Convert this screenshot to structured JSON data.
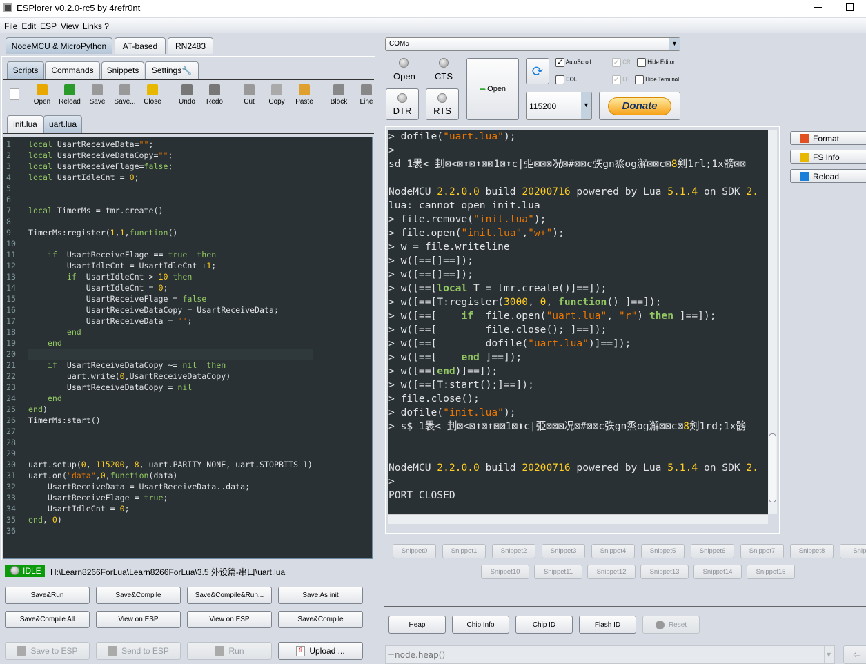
{
  "window": {
    "title": "ESPlorer v0.2.0-rc5 by 4refr0nt"
  },
  "menu": [
    "File",
    "Edit",
    "ESP",
    "View",
    "Links ?"
  ],
  "top_tabs": [
    "NodeMCU & MicroPython",
    "AT-based",
    "RN2483"
  ],
  "inner_tabs": [
    "Scripts",
    "Commands",
    "Snippets",
    "Settings"
  ],
  "toolbar": [
    "Open",
    "Reload",
    "Save",
    "Save...",
    "Close",
    "Undo",
    "Redo",
    "Cut",
    "Copy",
    "Paste",
    "Block",
    "Line"
  ],
  "file_tabs": [
    "init.lua",
    "uart.lua"
  ],
  "code_lines": [
    [
      [
        "local",
        "k"
      ],
      [
        " UsartReceiveData=",
        ""
      ],
      [
        "\"\"",
        "s"
      ],
      [
        ";",
        ""
      ]
    ],
    [
      [
        "local",
        "k"
      ],
      [
        " UsartReceiveDataCopy=",
        ""
      ],
      [
        "\"\"",
        "s"
      ],
      [
        ";",
        ""
      ]
    ],
    [
      [
        "local",
        "k"
      ],
      [
        " UsartReceiveFlage=",
        ""
      ],
      [
        "false",
        "k"
      ],
      [
        ";",
        ""
      ]
    ],
    [
      [
        "local",
        "k"
      ],
      [
        " UsartIdleCnt = ",
        ""
      ],
      [
        "0",
        "n"
      ],
      [
        ";",
        ""
      ]
    ],
    [],
    [],
    [
      [
        "local",
        "k"
      ],
      [
        " TimerMs = tmr.create()",
        ""
      ]
    ],
    [],
    [
      [
        "TimerMs:register(",
        ""
      ],
      [
        "1",
        "n"
      ],
      [
        ",",
        ""
      ],
      [
        "1",
        "n"
      ],
      [
        ",",
        ""
      ],
      [
        "function",
        "k"
      ],
      [
        "()",
        ""
      ]
    ],
    [],
    [
      [
        "    ",
        ""
      ],
      [
        "if",
        "k"
      ],
      [
        "  UsartReceiveFlage == ",
        ""
      ],
      [
        "true",
        "k"
      ],
      [
        "  ",
        ""
      ],
      [
        "then",
        "k"
      ]
    ],
    [
      [
        "        UsartIdleCnt = UsartIdleCnt +",
        ""
      ],
      [
        "1",
        "n"
      ],
      [
        ";",
        ""
      ]
    ],
    [
      [
        "        ",
        ""
      ],
      [
        "if",
        "k"
      ],
      [
        "  UsartIdleCnt > ",
        ""
      ],
      [
        "10",
        "n"
      ],
      [
        " ",
        ""
      ],
      [
        "then",
        "k"
      ]
    ],
    [
      [
        "            UsartIdleCnt = ",
        ""
      ],
      [
        "0",
        "n"
      ],
      [
        ";",
        ""
      ]
    ],
    [
      [
        "            UsartReceiveFlage = ",
        ""
      ],
      [
        "false",
        "k"
      ]
    ],
    [
      [
        "            UsartReceiveDataCopy = UsartReceiveData;",
        ""
      ]
    ],
    [
      [
        "            UsartReceiveData = ",
        ""
      ],
      [
        "\"\"",
        "s"
      ],
      [
        ";",
        ""
      ]
    ],
    [
      [
        "        ",
        ""
      ],
      [
        "end",
        "k"
      ]
    ],
    [
      [
        "    ",
        ""
      ],
      [
        "end",
        "k"
      ]
    ],
    [],
    [
      [
        "    ",
        ""
      ],
      [
        "if",
        "k"
      ],
      [
        "  UsartReceiveDataCopy ~= ",
        ""
      ],
      [
        "nil",
        "k"
      ],
      [
        "  ",
        ""
      ],
      [
        "then",
        "k"
      ]
    ],
    [
      [
        "        uart.write(",
        ""
      ],
      [
        "0",
        "n"
      ],
      [
        ",UsartReceiveDataCopy)",
        ""
      ]
    ],
    [
      [
        "        UsartReceiveDataCopy = ",
        ""
      ],
      [
        "nil",
        "k"
      ]
    ],
    [
      [
        "    ",
        ""
      ],
      [
        "end",
        "k"
      ]
    ],
    [
      [
        "end",
        "k"
      ],
      [
        ")",
        ""
      ]
    ],
    [
      [
        "TimerMs:start()",
        ""
      ]
    ],
    [],
    [],
    [],
    [
      [
        "uart.setup(",
        ""
      ],
      [
        "0",
        "n"
      ],
      [
        ", ",
        ""
      ],
      [
        "115200",
        "n"
      ],
      [
        ", ",
        ""
      ],
      [
        "8",
        "n"
      ],
      [
        ", uart.PARITY_NONE, uart.STOPBITS_1)",
        ""
      ]
    ],
    [
      [
        "uart.on(",
        ""
      ],
      [
        "\"data\"",
        "s"
      ],
      [
        ",",
        ""
      ],
      [
        "0",
        "n"
      ],
      [
        ",",
        ""
      ],
      [
        "function",
        "k"
      ],
      [
        "(data)",
        ""
      ]
    ],
    [
      [
        "    UsartReceiveData = UsartReceiveData..data;",
        ""
      ]
    ],
    [
      [
        "    UsartReceiveFlage = ",
        ""
      ],
      [
        "true",
        "k"
      ],
      [
        ";",
        ""
      ]
    ],
    [
      [
        "    UsartIdleCnt = ",
        ""
      ],
      [
        "0",
        "n"
      ],
      [
        ";",
        ""
      ]
    ],
    [
      [
        "end",
        "k"
      ],
      [
        ", ",
        ""
      ],
      [
        "0",
        "n"
      ],
      [
        ")",
        ""
      ]
    ],
    []
  ],
  "status": {
    "state": "IDLE",
    "path": "H:\\Learn8266ForLua\\Learn8266ForLua\\3.5 外设篇-串口\\uart.lua"
  },
  "buttons_row1": [
    "Save&Run",
    "Save&Compile",
    "Save&Compile&Run...",
    "Save As init"
  ],
  "buttons_row2": [
    "Save&Compile All",
    "View on ESP",
    "View on ESP",
    "Save&Compile"
  ],
  "buttons_row3": [
    "Save to ESP",
    "Send to ESP",
    "Run",
    "Upload ..."
  ],
  "port": {
    "value": "COM5",
    "baud": "115200",
    "open_label": "Open",
    "led_open": "Open",
    "led_cts": "CTS",
    "dtr": "DTR",
    "rts": "RTS",
    "donate": "Donate"
  },
  "options": {
    "autoscroll": "AutoScroll",
    "eol": "EOL",
    "cr": "CR",
    "lf": "LF",
    "hide_editor": "Hide Editor",
    "hide_terminal": "Hide Terminal"
  },
  "terminal_lines": [
    [
      [
        "> dofile(",
        ""
      ],
      [
        "\"uart.lua\"",
        "s"
      ],
      [
        ");",
        ""
      ]
    ],
    [
      [
        ">",
        ""
      ]
    ],
    [
      [
        "sd 1褁< 刲⊠<⊠⬆⊠⬆⊠⊠1⊠⬆c|弫⊠⊠⊠况⊠#⊠⊠c矤gn烝og澥⊠⊠c⊠",
        ""
      ],
      [
        "8",
        "n"
      ],
      [
        "剣1rl;1x髈⊠⊠",
        ""
      ]
    ],
    [],
    [
      [
        "NodeMCU ",
        ""
      ],
      [
        "2.2.0.0",
        "n"
      ],
      [
        " build ",
        ""
      ],
      [
        "20200716",
        "n"
      ],
      [
        " powered by Lua ",
        ""
      ],
      [
        "5.1.4",
        "n"
      ],
      [
        " on SDK ",
        ""
      ],
      [
        "2.",
        "n"
      ]
    ],
    [
      [
        "lua: cannot open init.lua",
        ""
      ]
    ],
    [
      [
        "> file.remove(",
        ""
      ],
      [
        "\"init.lua\"",
        "s"
      ],
      [
        ");",
        ""
      ]
    ],
    [
      [
        "> file.open(",
        ""
      ],
      [
        "\"init.lua\"",
        "s"
      ],
      [
        ",",
        ""
      ],
      [
        "\"w+\"",
        "s"
      ],
      [
        ");",
        ""
      ]
    ],
    [
      [
        "> w = file.writeline",
        ""
      ]
    ],
    [
      [
        "> w([==[]==]);",
        ""
      ]
    ],
    [
      [
        "> w([==[]==]);",
        ""
      ]
    ],
    [
      [
        "> w([==[",
        ""
      ],
      [
        "local",
        "kb"
      ],
      [
        " T = tmr.create()]==]);",
        ""
      ]
    ],
    [
      [
        "> w([==[T:register(",
        ""
      ],
      [
        "3000",
        "n"
      ],
      [
        ", ",
        ""
      ],
      [
        "0",
        "n"
      ],
      [
        ", ",
        ""
      ],
      [
        "function",
        "kb"
      ],
      [
        "() ]==]);",
        ""
      ]
    ],
    [
      [
        "> w([==[    ",
        ""
      ],
      [
        "if",
        "kb"
      ],
      [
        "  file.open(",
        ""
      ],
      [
        "\"uart.lua\"",
        "s"
      ],
      [
        ", ",
        ""
      ],
      [
        "\"r\"",
        "s"
      ],
      [
        ") ",
        ""
      ],
      [
        "then",
        "kb"
      ],
      [
        " ]==]);",
        ""
      ]
    ],
    [
      [
        "> w([==[        file.close(); ]==]);",
        ""
      ]
    ],
    [
      [
        "> w([==[        dofile(",
        ""
      ],
      [
        "\"uart.lua\"",
        "s"
      ],
      [
        ")]==]);",
        ""
      ]
    ],
    [
      [
        "> w([==[    ",
        ""
      ],
      [
        "end",
        "kb"
      ],
      [
        " ]==]);",
        ""
      ]
    ],
    [
      [
        "> w([==[",
        ""
      ],
      [
        "end",
        "kb"
      ],
      [
        ")]==]);",
        ""
      ]
    ],
    [
      [
        "> w([==[T:start();]==]);",
        ""
      ]
    ],
    [
      [
        "> file.close();",
        ""
      ]
    ],
    [
      [
        "> dofile(",
        ""
      ],
      [
        "\"init.lua\"",
        "s"
      ],
      [
        ");",
        ""
      ]
    ],
    [
      [
        "> s$ 1褁< 刲⊠<⊠⬆⊠⬆⊠⊠1⊠⬆c|弫⊠⊠⊠况⊠#⊠⊠c矤gn烝og澥⊠⊠c⊠",
        ""
      ],
      [
        "8",
        "n"
      ],
      [
        "剣1rd;1x髈",
        ""
      ]
    ],
    [],
    [],
    [
      [
        "NodeMCU ",
        ""
      ],
      [
        "2.2.0.0",
        "n"
      ],
      [
        " build ",
        ""
      ],
      [
        "20200716",
        "n"
      ],
      [
        " powered by Lua ",
        ""
      ],
      [
        "5.1.4",
        "n"
      ],
      [
        " on SDK ",
        ""
      ],
      [
        "2.",
        "n"
      ]
    ],
    [
      [
        ">",
        ""
      ]
    ],
    [
      [
        "PORT CLOSED",
        ""
      ]
    ]
  ],
  "side_buttons": [
    "Format",
    "FS Info",
    "Reload"
  ],
  "snippets_row1": [
    "Snippet0",
    "Snippet1",
    "Snippet2",
    "Snippet3",
    "Snippet4",
    "Snippet5",
    "Snippet6",
    "Snippet7",
    "Snippet8",
    "Snipp"
  ],
  "snippets_row2": [
    "Snippet10",
    "Snippet11",
    "Snippet12",
    "Snippet13",
    "Snippet14",
    "Snippet15"
  ],
  "bottom_buttons": [
    "Heap",
    "Chip Info",
    "Chip ID",
    "Flash ID",
    "Reset"
  ],
  "command_input": "=node.heap()",
  "colors": {
    "editor_bg": "#293134",
    "keyword": "#93c763",
    "string": "#ec7600",
    "number": "#ffcd22",
    "idle": "#0a9a0a"
  }
}
